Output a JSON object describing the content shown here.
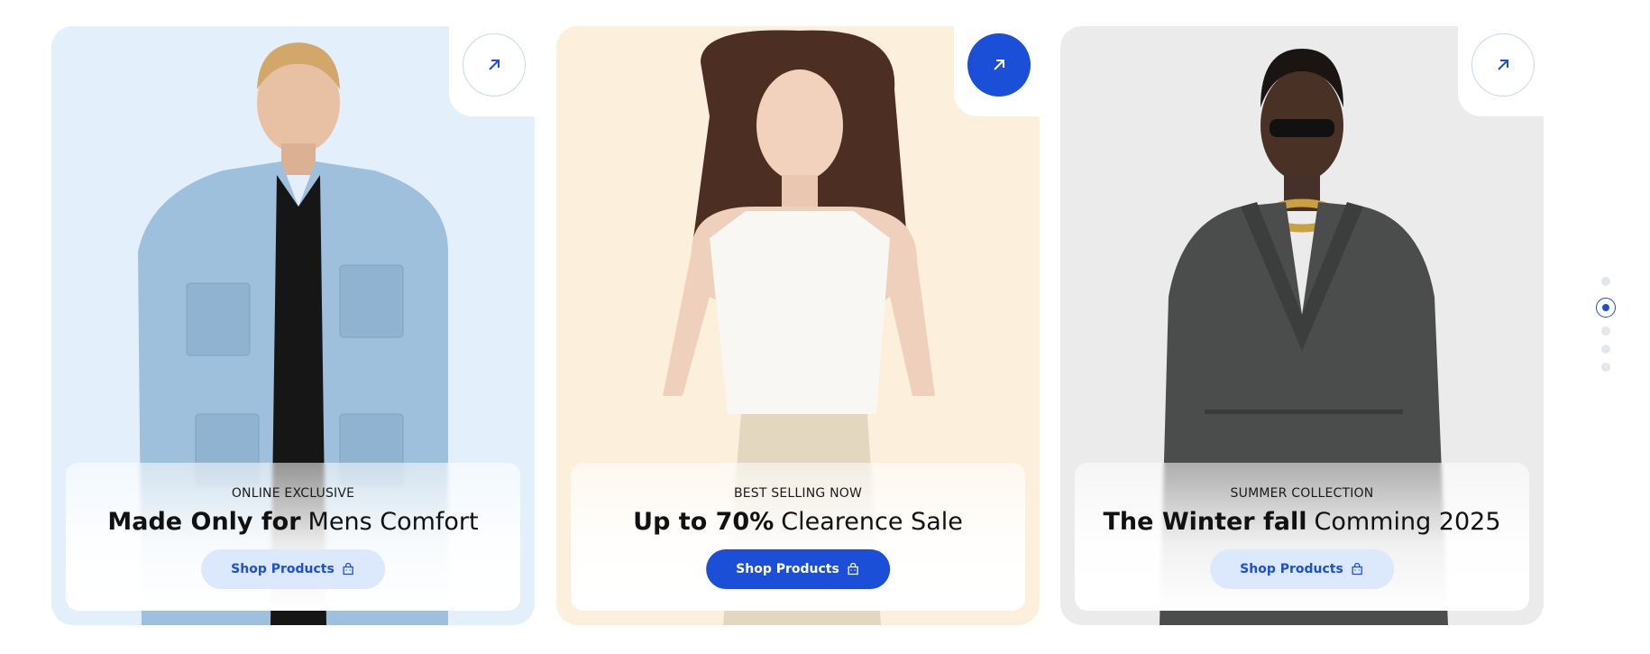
{
  "colors": {
    "accent": "#1c4fd8",
    "card_bg_1": "#e3f0fc",
    "card_bg_2": "#fcefdc",
    "card_bg_3": "#ebebeb"
  },
  "cards": [
    {
      "eyebrow": "ONLINE EXCLUSIVE",
      "headline_strong": "Made Only for",
      "headline_light": "Mens Comfort",
      "button_label": "Shop Products",
      "arrow_icon": "arrow-up-right-icon"
    },
    {
      "eyebrow": "BEST SELLING NOW",
      "headline_strong": "Up to 70%",
      "headline_light": "Clearence Sale",
      "button_label": "Shop Products",
      "arrow_icon": "arrow-up-right-icon"
    },
    {
      "eyebrow": "SUMMER COLLECTION",
      "headline_strong": "The Winter fall",
      "headline_light": "Comming 2025",
      "button_label": "Shop Products",
      "arrow_icon": "arrow-up-right-icon"
    }
  ],
  "pagination": {
    "total": 5,
    "active_index": 1
  }
}
